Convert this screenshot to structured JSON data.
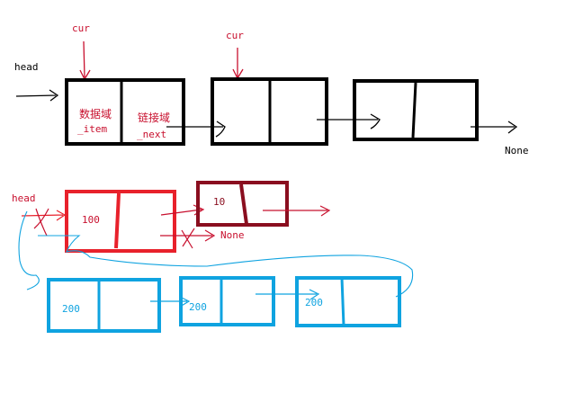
{
  "labels": {
    "cur_1": "cur",
    "cur_2": "cur",
    "head_top": "head",
    "data_field": "数据域",
    "item_name": "_item",
    "link_field": "链接域",
    "next_name": "_next",
    "none_top": "None",
    "head_red": "head",
    "val_100": "100",
    "val_10": "10",
    "none_red": "None",
    "val_200_a": "200",
    "val_200_b": "200",
    "val_200_c": "200"
  },
  "colors": {
    "black": "#000000",
    "red": "#e8212b",
    "dark_red": "#8a0e1f",
    "text_red": "#c8102e",
    "blue": "#0fa3e0"
  }
}
